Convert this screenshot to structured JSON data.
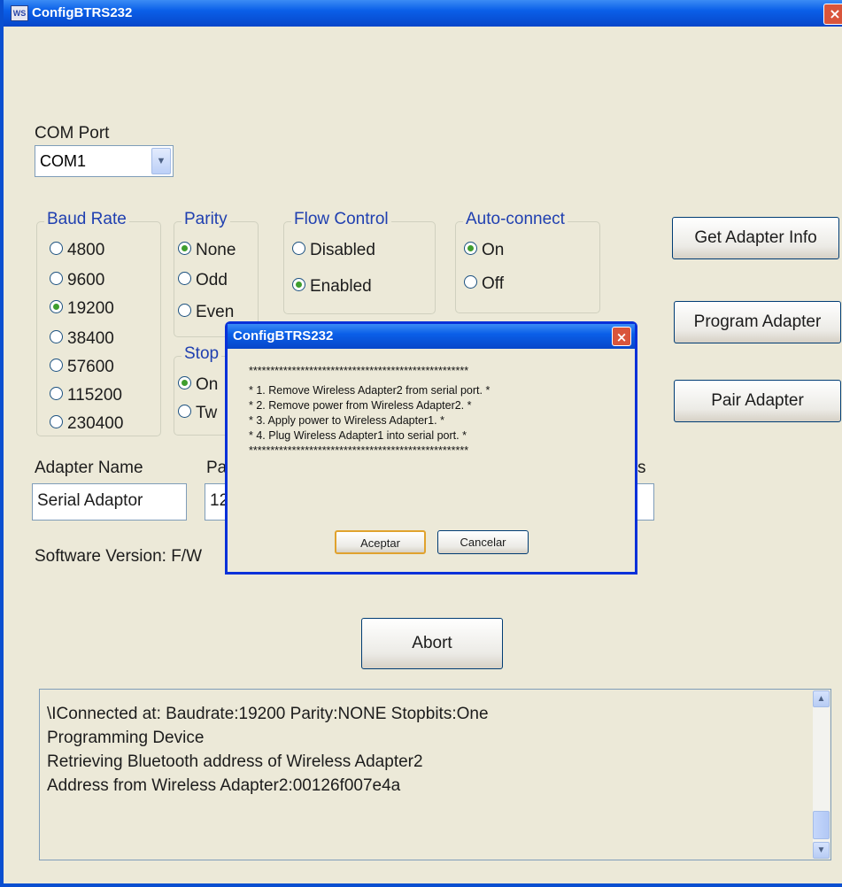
{
  "window": {
    "title": "ConfigBTRS232",
    "icon_text": "WS",
    "close_glyph": "×"
  },
  "com_port": {
    "label": "COM Port",
    "value": "COM1",
    "arrow": "▼"
  },
  "baud_rate": {
    "label": "Baud Rate",
    "options": [
      "4800",
      "9600",
      "19200",
      "38400",
      "57600",
      "115200",
      "230400"
    ],
    "selected": "19200"
  },
  "parity": {
    "label": "Parity",
    "options": [
      "None",
      "Odd",
      "Even"
    ],
    "selected": "None"
  },
  "stop_bits": {
    "label": "Stop",
    "options": [
      "On",
      "Tw"
    ],
    "selected": "On"
  },
  "flow_control": {
    "label": "Flow Control",
    "options": [
      "Disabled",
      "Enabled"
    ],
    "selected": "Enabled"
  },
  "auto_connect": {
    "label": "Auto-connect",
    "options": [
      "On",
      "Off"
    ],
    "selected": "On"
  },
  "buttons": {
    "get_info": "Get Adapter Info",
    "program": "Program Adapter",
    "pair": "Pair Adapter",
    "abort": "Abort"
  },
  "adapter": {
    "name_label": "Adapter Name",
    "name_value": "Serial Adaptor",
    "pass_label_partial": "Pa",
    "pass_value_partial": "12",
    "third_label_partial": "s"
  },
  "software_version": {
    "label_partial": "Software Version: F/W"
  },
  "log": {
    "lines": [
      "\\IConnected at: Baudrate:19200 Parity:NONE Stopbits:One",
      "Programming Device",
      "Retrieving Bluetooth address of Wireless Adapter2",
      "Address from Wireless Adapter2:00126f007e4a"
    ],
    "scroll_up": "▲",
    "scroll_down": "▼"
  },
  "dialog": {
    "title": "ConfigBTRS232",
    "close_glyph": "×",
    "lines": [
      "***************************************************",
      "* 1. Remove Wireless Adapter2 from serial port. *",
      "* 2. Remove power from Wireless Adapter2.       *",
      "* 3. Apply power to Wireless Adapter1.          *",
      "* 4. Plug Wireless Adapter1 into serial port.   *",
      "***************************************************"
    ],
    "ok_label": "Aceptar",
    "cancel_label": "Cancelar"
  }
}
